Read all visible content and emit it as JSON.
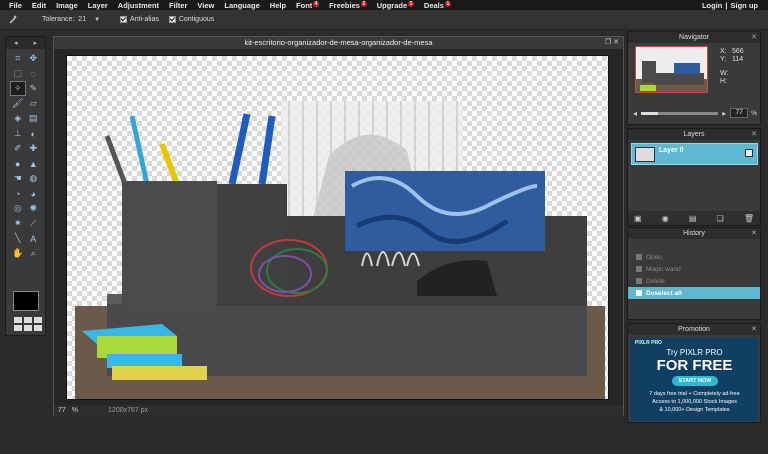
{
  "menubar": {
    "items": [
      {
        "label": "File"
      },
      {
        "label": "Edit"
      },
      {
        "label": "Image"
      },
      {
        "label": "Layer"
      },
      {
        "label": "Adjustment"
      },
      {
        "label": "Filter"
      },
      {
        "label": "View"
      },
      {
        "label": "Language"
      },
      {
        "label": "Help"
      },
      {
        "label": "Font",
        "badge": "4"
      },
      {
        "label": "Freebies",
        "badge": "2"
      },
      {
        "label": "Upgrade",
        "badge": "1"
      },
      {
        "label": "Deals",
        "badge": "1"
      }
    ],
    "login": "Login",
    "separator": "|",
    "signup": "Sign up"
  },
  "options": {
    "tolerance_label": "Tolerance:",
    "tolerance_value": "21",
    "antialias_label": "Anti-alias",
    "contiguous_label": "Contiguous"
  },
  "toolbox": {
    "tools": [
      "crop-icon",
      "move-icon",
      "marquee-icon",
      "lasso-icon",
      "wand-icon",
      "pencil-icon",
      "brush-icon",
      "eraser-icon",
      "bucket-icon",
      "gradient-icon",
      "stamp-icon",
      "colorreplace-icon",
      "drawing-icon",
      "spot-heal-icon",
      "blur-icon",
      "sharpen-icon",
      "smudge-icon",
      "sponge-icon",
      "dodge-icon",
      "burn-icon",
      "redeye-icon",
      "bloat-icon",
      "pinch-icon",
      "picker-icon",
      "line-icon",
      "text-icon",
      "hand-icon",
      "zoom-icon"
    ],
    "primary_color": "#000000"
  },
  "canvas": {
    "title": "kit-escritorio-organizador-de-mesa-organizador-de-mesa",
    "zoom": "77",
    "zoom_unit": "%",
    "size": "1200x767 px"
  },
  "navigator": {
    "title": "Navigator",
    "x_label": "X:",
    "x_value": "566",
    "y_label": "Y:",
    "y_value": "114",
    "w_label": "W:",
    "h_label": "H:",
    "zoom_value": "77",
    "zoom_unit": "%",
    "zoom_level": 0.22
  },
  "layers": {
    "title": "Layers",
    "items": [
      {
        "name": "Layer 0",
        "visible": true
      }
    ]
  },
  "history": {
    "title": "History",
    "items": [
      {
        "label": "Open",
        "active": false
      },
      {
        "label": "Magic wand",
        "active": false
      },
      {
        "label": "Delete",
        "active": false
      },
      {
        "label": "Deselect all",
        "active": true
      }
    ]
  },
  "promotion": {
    "title": "Promotion",
    "brand": "PIXLR PRO",
    "headline": "Try PIXLR PRO",
    "big": "FOR FREE",
    "button": "START NOW",
    "line1": "7 days free trial + Completely ad-free",
    "line2": "Access to 1,000,000 Stock Images",
    "line3": "& 10,000+ Design Templates"
  },
  "colors": {
    "accent": "#5fb8d2",
    "badge": "#d91a1a",
    "promo_bg": "#0f3f63"
  }
}
